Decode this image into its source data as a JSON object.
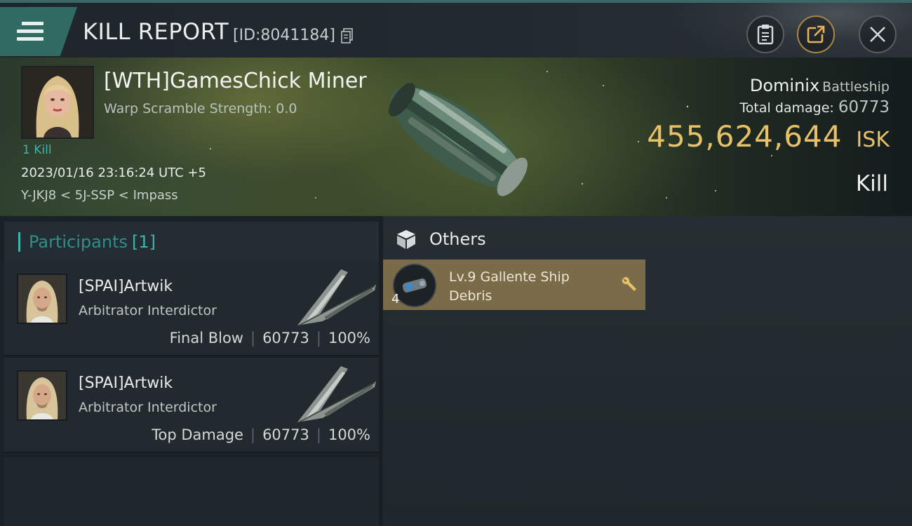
{
  "header": {
    "title": "KILL REPORT",
    "report_id": "[ID:8041184]"
  },
  "victim": {
    "name": "[WTH]GamesChick Miner",
    "warp_scramble": "Warp Scramble Strength: 0.0",
    "kill_count": "1 Kill",
    "timestamp": "2023/01/16 23:16:24 UTC +5",
    "location": "Y-JKJ8 < 5J-SSP < Impass",
    "ship_name": "Dominix",
    "ship_class": "Battleship",
    "total_damage_label": "Total damage:",
    "total_damage_value": "60773",
    "isk_value": "455,624,644",
    "isk_currency": "ISK",
    "kill_type": "Kill"
  },
  "participants": {
    "label": "Participants",
    "count": "[1]",
    "rows": [
      {
        "name": "[SPAI]Artwik",
        "ship": "Arbitrator Interdictor",
        "role": "Final Blow",
        "damage": "60773",
        "percent": "100%"
      },
      {
        "name": "[SPAI]Artwik",
        "ship": "Arbitrator Interdictor",
        "role": "Top Damage",
        "damage": "60773",
        "percent": "100%"
      }
    ]
  },
  "others": {
    "label": "Others",
    "items": [
      {
        "name": "Lv.9 Gallente Ship Debris",
        "quantity": "4"
      }
    ]
  },
  "colors": {
    "accent_teal": "#3fb4ae",
    "isk_gold": "#e8c06a",
    "debris_bg": "#7a6c48",
    "menu_teal": "#2f6a63"
  }
}
